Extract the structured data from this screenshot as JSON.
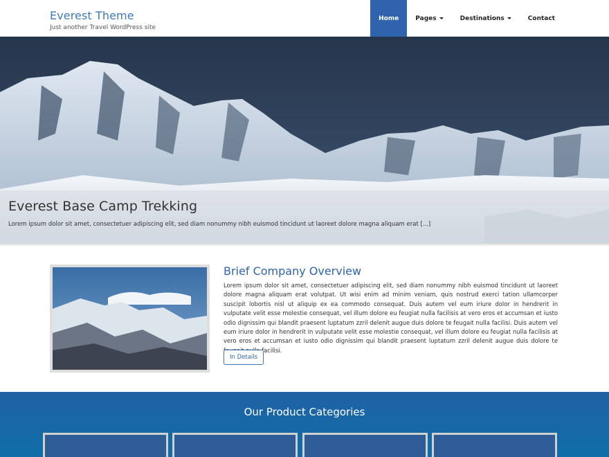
{
  "site": {
    "title": "Everest Theme",
    "tagline": "Just another Travel WordPress site"
  },
  "nav": {
    "items": [
      {
        "label": "Home",
        "active": true
      },
      {
        "label": "Pages",
        "dropdown": true
      },
      {
        "label": "Destinations",
        "dropdown": true
      },
      {
        "label": "Contact"
      }
    ]
  },
  "hero": {
    "title": "Everest Base Camp Trekking",
    "excerpt": "Lorem ipsum dolor sit amet, consectetuer adipiscing elit, sed diam nonummy nibh euismod tincidunt ut laoreet dolore magna aliquam erat [...]"
  },
  "overview": {
    "title": "Brief Company Overview",
    "body": "Lorem ipsum dolor sit amet, consectetuer adipiscing elit, sed diam nonummy nibh euismod tincidunt ut laoreet dolore magna aliquam erat volutpat. Ut wisi enim ad minim veniam, quis nostrud exerci tation ullamcorper suscipit lobortis nisl ut aliquip ex ea commodo consequat. Duis autem vel eum iriure dolor in hendrerit in vulputate velit esse molestie consequat, vel illum dolore eu feugiat nulla facilisis at vero eros et accumsan et iusto odio dignissim qui blandit praesent luptatum zzril delenit augue duis dolore te feugait nulla facilisi. Duis autem vel eum iriure dolor in hendrerit in vulputate velit esse molestie consequat, vel illum dolore eu feugiat nulla facilisis at vero eros et accumsan et iusto odio dignissim qui blandit praesent luptatum zzril delenit augue duis dolore te feugait nulla facilisi.",
    "button_label": "In Details"
  },
  "categories": {
    "title": "Our Product Categories",
    "cards": 4
  },
  "colors": {
    "accent": "#2f63ad",
    "title_blue": "#3d7ab8",
    "band_blue": "#1566a6"
  }
}
